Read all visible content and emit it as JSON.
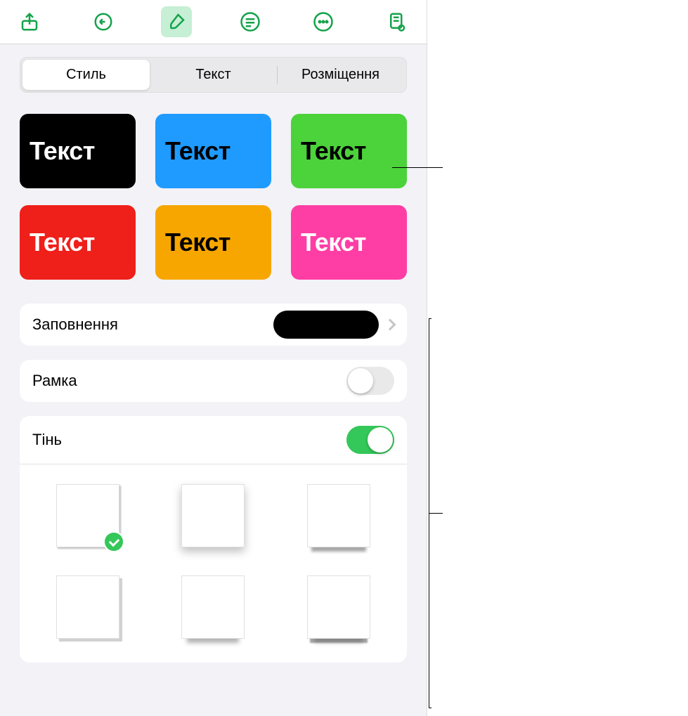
{
  "tabs": {
    "style": "Стиль",
    "text": "Текст",
    "layout": "Розміщення"
  },
  "presets": {
    "label": "Текст",
    "items": [
      {
        "bg": "#000000",
        "fg": "#ffffff"
      },
      {
        "bg": "#1f9bff",
        "fg": "#000000"
      },
      {
        "bg": "#4cd23a",
        "fg": "#000000"
      },
      {
        "bg": "#ef1f1a",
        "fg": "#ffffff"
      },
      {
        "bg": "#f7a600",
        "fg": "#000000"
      },
      {
        "bg": "#ff3ea5",
        "fg": "#ffffff"
      }
    ]
  },
  "fill": {
    "label": "Заповнення",
    "color": "#000000"
  },
  "border": {
    "label": "Рамка",
    "on": false
  },
  "shadow": {
    "label": "Тінь",
    "on": true,
    "selected": 0
  }
}
